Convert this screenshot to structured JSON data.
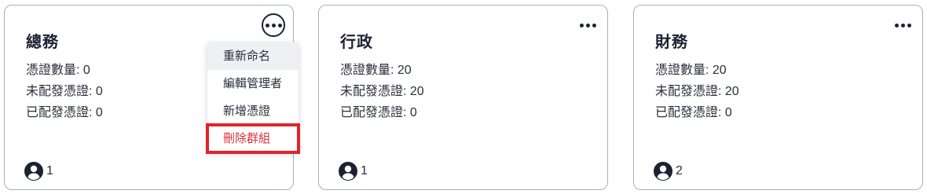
{
  "cards": [
    {
      "title": "總務",
      "stats": [
        "憑證數量: 0",
        "未配發憑證: 0",
        "已配發憑證: 0"
      ],
      "member_count": "1",
      "menu_open": true
    },
    {
      "title": "行政",
      "stats": [
        "憑證數量: 20",
        "未配發憑證: 20",
        "已配發憑證: 0"
      ],
      "member_count": "1",
      "menu_open": false
    },
    {
      "title": "財務",
      "stats": [
        "憑證數量: 20",
        "未配發憑證: 20",
        "已配發憑證: 0"
      ],
      "member_count": "2",
      "menu_open": false
    }
  ],
  "menu": {
    "items": [
      "重新命名",
      "編輯管理者",
      "新增憑證",
      "刪除群組"
    ]
  },
  "icons": {
    "more": "more-horizontal-icon",
    "member": "user-circle-icon"
  },
  "colors": {
    "danger": "#d8323c",
    "highlight_box": "#e0242c",
    "text": "#1c2232",
    "border": "#a9b0bb"
  }
}
